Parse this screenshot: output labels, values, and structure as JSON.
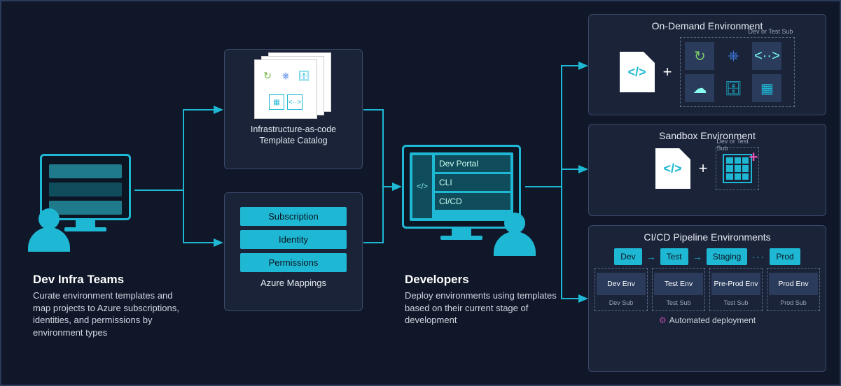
{
  "devinfra": {
    "title": "Dev Infra Teams",
    "desc": "Curate environment templates and map projects to Azure subscriptions, identities, and permissions by environment types"
  },
  "iac": {
    "label": "Infrastructure-as-code Template Catalog"
  },
  "azure": {
    "items": [
      "Subscription",
      "Identity",
      "Permissions"
    ],
    "label": "Azure Mappings"
  },
  "developers": {
    "title": "Developers",
    "desc": "Deploy environments using templates based on their current stage of development",
    "items": [
      "Dev Portal",
      "CLI",
      "CI/CD"
    ],
    "code_glyph": "</>"
  },
  "env": {
    "ondemand": {
      "title": "On-Demand Environment",
      "sub_label": "Dev or Test Sub",
      "plus": "+",
      "code_glyph": "</>"
    },
    "sandbox": {
      "title": "Sandbox Environment",
      "sub_label": "Dev or Test Sub",
      "plus": "+",
      "code_glyph": "</>"
    },
    "pipeline": {
      "title": "CI/CD Pipeline Environments",
      "stages": [
        "Dev",
        "Test",
        "Staging",
        "Prod"
      ],
      "dots": "···",
      "envs": [
        {
          "name": "Dev Env",
          "sub": "Dev Sub"
        },
        {
          "name": "Test Env",
          "sub": "Test Sub"
        },
        {
          "name": "Pre-Prod Env",
          "sub": "Test Sub"
        },
        {
          "name": "Prod Env",
          "sub": "Prod Sub"
        }
      ],
      "auto": "Automated deployment"
    }
  }
}
